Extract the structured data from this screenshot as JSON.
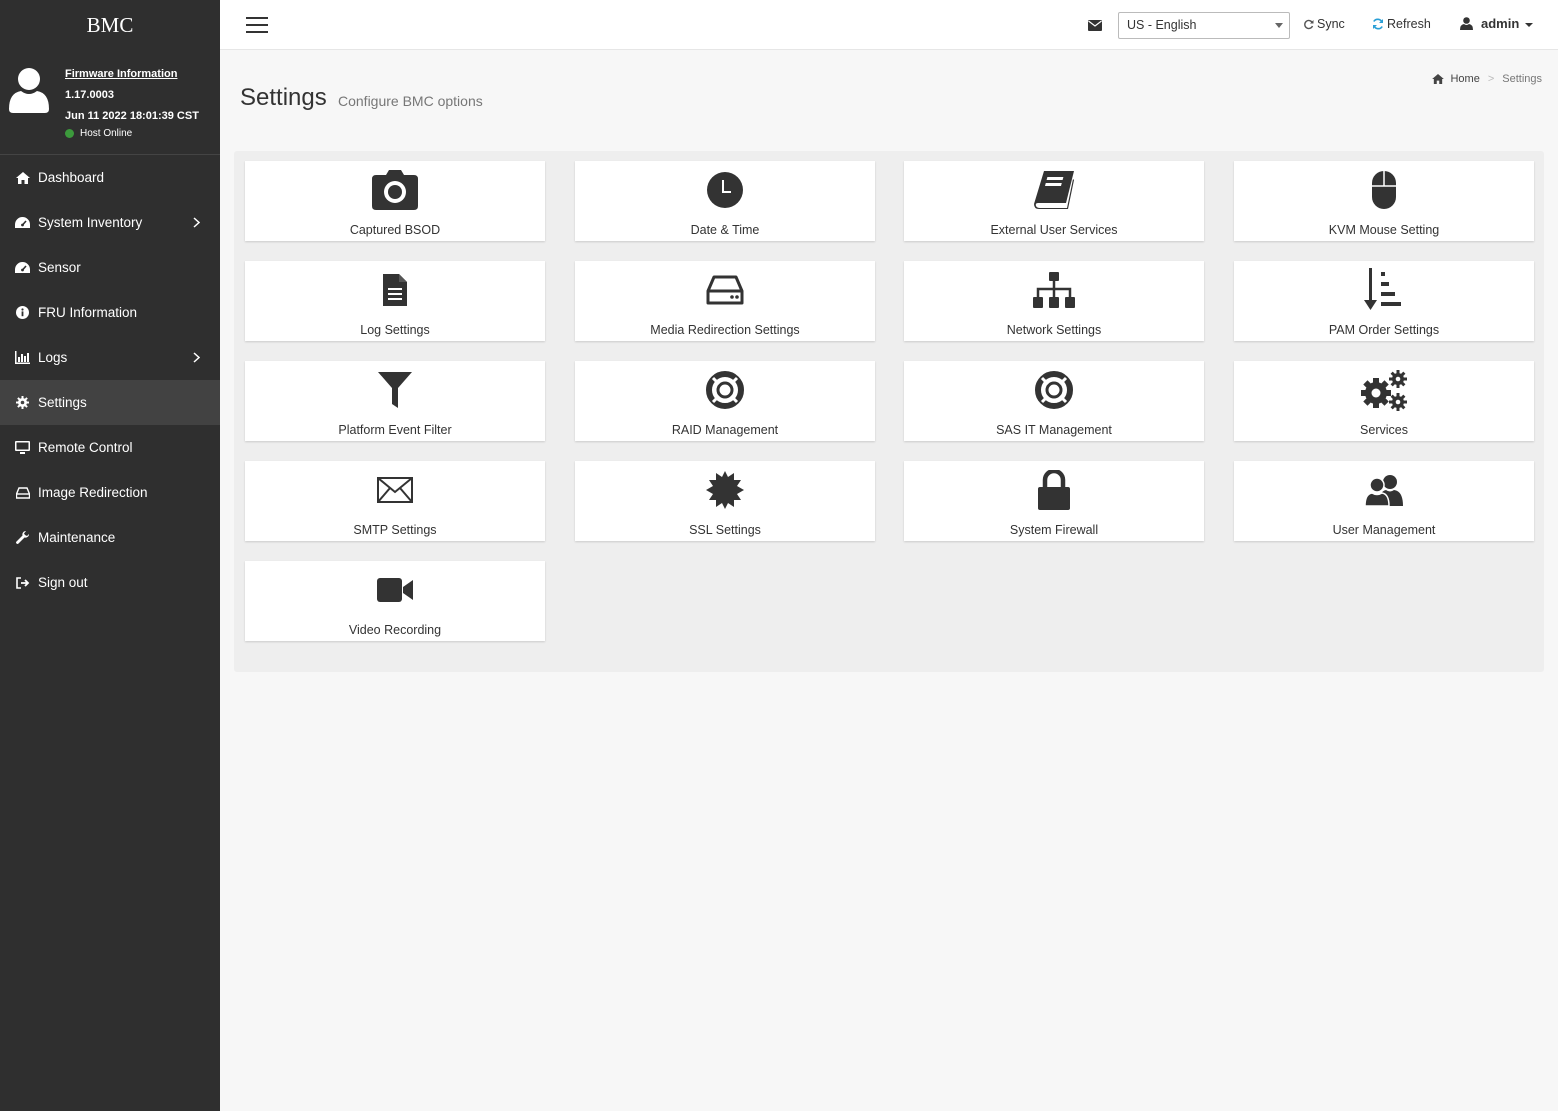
{
  "brand": "BMC",
  "firmware": {
    "link_label": "Firmware Information",
    "version": "1.17.0003",
    "date": "Jun 11 2022 18:01:39 CST",
    "host_status": "Host Online",
    "host_status_color": "#3c9a3c"
  },
  "nav": {
    "items": [
      {
        "label": "Dashboard",
        "icon": "home-icon"
      },
      {
        "label": "System Inventory",
        "icon": "dashboard-gauge-icon",
        "has_children": true
      },
      {
        "label": "Sensor",
        "icon": "gauge-icon"
      },
      {
        "label": "FRU Information",
        "icon": "info-icon"
      },
      {
        "label": "Logs",
        "icon": "bar-chart-icon",
        "has_children": true
      },
      {
        "label": "Settings",
        "icon": "gear-icon",
        "active": true
      },
      {
        "label": "Remote Control",
        "icon": "monitor-icon"
      },
      {
        "label": "Image Redirection",
        "icon": "hdd-icon"
      },
      {
        "label": "Maintenance",
        "icon": "wrench-icon"
      },
      {
        "label": "Sign out",
        "icon": "sign-out-icon"
      }
    ]
  },
  "topbar": {
    "language": "US - English",
    "sync_label": "Sync",
    "refresh_label": "Refresh",
    "user": "admin"
  },
  "page": {
    "title": "Settings",
    "subtitle": "Configure BMC options",
    "breadcrumb_home": "Home",
    "breadcrumb_current": "Settings"
  },
  "tiles": [
    {
      "label": "Captured BSOD",
      "icon": "camera-icon"
    },
    {
      "label": "Date & Time",
      "icon": "clock-icon"
    },
    {
      "label": "External User Services",
      "icon": "book-icon"
    },
    {
      "label": "KVM Mouse Setting",
      "icon": "mouse-icon"
    },
    {
      "label": "Log Settings",
      "icon": "file-text-icon"
    },
    {
      "label": "Media Redirection Settings",
      "icon": "hdd-icon"
    },
    {
      "label": "Network Settings",
      "icon": "sitemap-icon"
    },
    {
      "label": "PAM Order Settings",
      "icon": "sort-amount-icon"
    },
    {
      "label": "Platform Event Filter",
      "icon": "filter-icon"
    },
    {
      "label": "RAID Management",
      "icon": "life-ring-icon"
    },
    {
      "label": "SAS IT Management",
      "icon": "life-ring-icon"
    },
    {
      "label": "Services",
      "icon": "cogs-icon"
    },
    {
      "label": "SMTP Settings",
      "icon": "envelope-icon"
    },
    {
      "label": "SSL Settings",
      "icon": "certificate-icon"
    },
    {
      "label": "System Firewall",
      "icon": "lock-icon"
    },
    {
      "label": "User Management",
      "icon": "users-icon"
    },
    {
      "label": "Video Recording",
      "icon": "video-camera-icon"
    }
  ]
}
